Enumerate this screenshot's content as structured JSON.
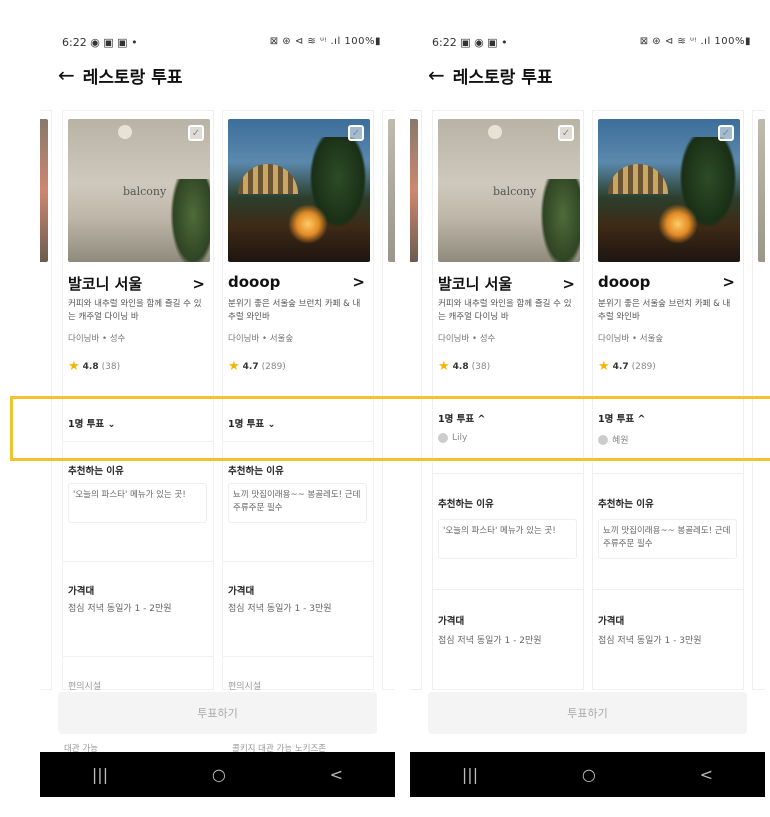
{
  "status_bar": {
    "p1_left": "6:22 ◉ ▣ ▣ •",
    "p2_left": "6:22 ▣ ◉ ▣ •",
    "right": "⊠ ⊛ ⊲ ≋ ᵘᵎ .ıl 100%▮"
  },
  "header": {
    "back_icon": "←",
    "title": "레스토랑 투표"
  },
  "restaurants": [
    {
      "name": "발코니 서울",
      "image_text": "balcony",
      "description": "커피와 내추럴 와인을 함께 즐길 수 있는 캐주얼 다이닝 바",
      "category": "다이닝바 • 성수",
      "rating": "4.8",
      "review_count": "(38)",
      "vote_closed": "1명 투표 ⌄",
      "vote_open": "1명 투표 ^",
      "voter": "Lily",
      "reason_title": "추천하는 이유",
      "reason": "'오늘의 파스타' 메뉴가 있는 곳!",
      "price_title": "가격대",
      "price": "점심 저녁 동일가 1 - 2만원",
      "conv_title": "편의시설",
      "conv_under": "대관 가능"
    },
    {
      "name": "dooop",
      "image_text": "",
      "description": "분위기 좋은 서울숲 브런치 카페 & 내추럴 와인바",
      "category": "다이닝바 • 서울숲",
      "rating": "4.7",
      "review_count": "(289)",
      "vote_closed": "1명 투표 ⌄",
      "vote_open": "1명 투표 ^",
      "voter": "혜원",
      "reason_title": "추천하는 이유",
      "reason": "뇨끼 맛집이래용~~ 봉골레도! 근데 주류주문 필수",
      "price_title": "가격대",
      "price": "점심 저녁 동일가 1 - 3만원",
      "conv_title": "편의시설",
      "conv_under": "콜키지   대관 가능   노키즈존"
    }
  ],
  "vote_button": "투표하기",
  "navbar": {
    "recent": "|||",
    "home": "○",
    "back": "<"
  },
  "colors": {
    "highlight": "#f2c230",
    "star": "#f4b400"
  }
}
